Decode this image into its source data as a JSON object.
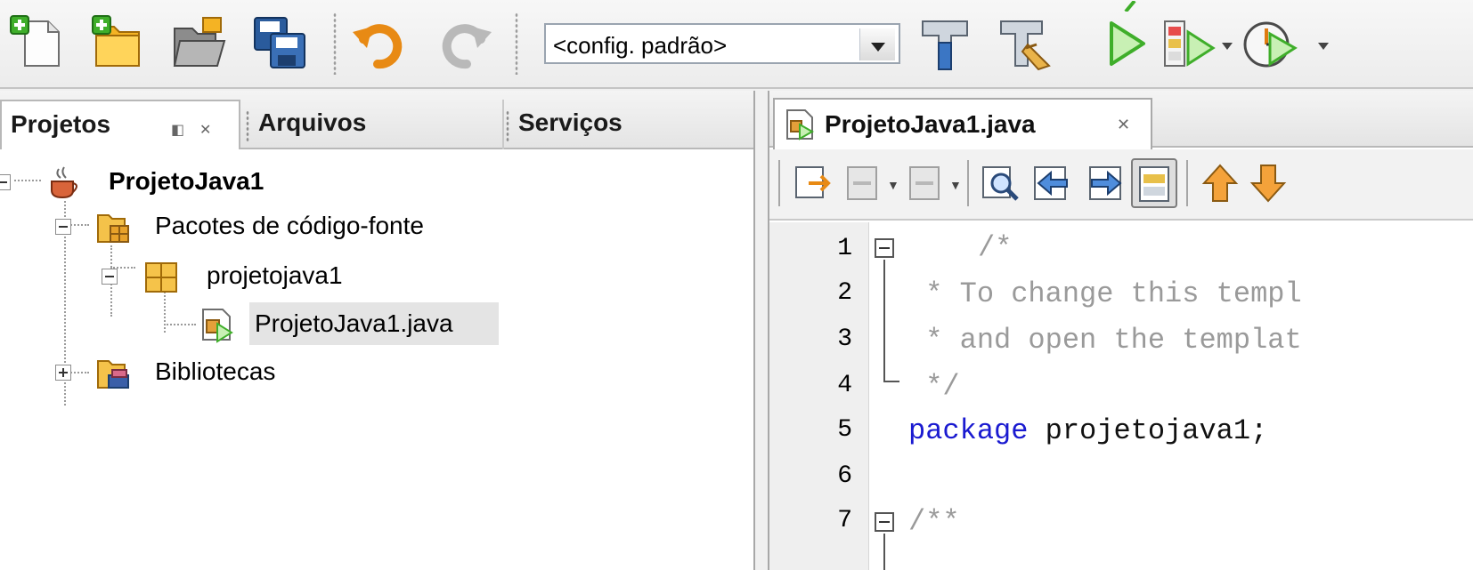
{
  "toolbar": {
    "buttons": [
      {
        "name": "new-file-icon"
      },
      {
        "name": "new-project-icon"
      },
      {
        "name": "open-project-icon"
      },
      {
        "name": "save-all-icon"
      },
      {
        "name": "undo-icon"
      },
      {
        "name": "redo-icon"
      },
      {
        "name": "build-icon"
      },
      {
        "name": "clean-build-icon"
      },
      {
        "name": "run-icon"
      },
      {
        "name": "debug-icon"
      },
      {
        "name": "profile-icon"
      }
    ],
    "config_select": "<config. padrão>"
  },
  "left_panel": {
    "tabs": [
      {
        "label": "Projetos",
        "active": true
      },
      {
        "label": "Arquivos",
        "active": false
      },
      {
        "label": "Serviços",
        "active": false
      }
    ],
    "tree": {
      "project": "ProjetoJava1",
      "source_packages": "Pacotes de código-fonte",
      "package": "projetojava1",
      "file": "ProjetoJava1.java",
      "libraries": "Bibliotecas"
    }
  },
  "editor": {
    "tab_label": "ProjetoJava1.java",
    "line_numbers": [
      "1",
      "2",
      "3",
      "4",
      "5",
      "6",
      "7"
    ],
    "lines": {
      "l1": "/*",
      "l2": " * To change this templ",
      "l3": " * and open the templat",
      "l4": " */",
      "l5_kw": "package",
      "l5_rest": " projetojava1;",
      "l7": "/**"
    }
  },
  "colors": {
    "accent_green": "#3fae2a",
    "keyword": "#1a1ad0",
    "comment": "#9a9a9a"
  }
}
